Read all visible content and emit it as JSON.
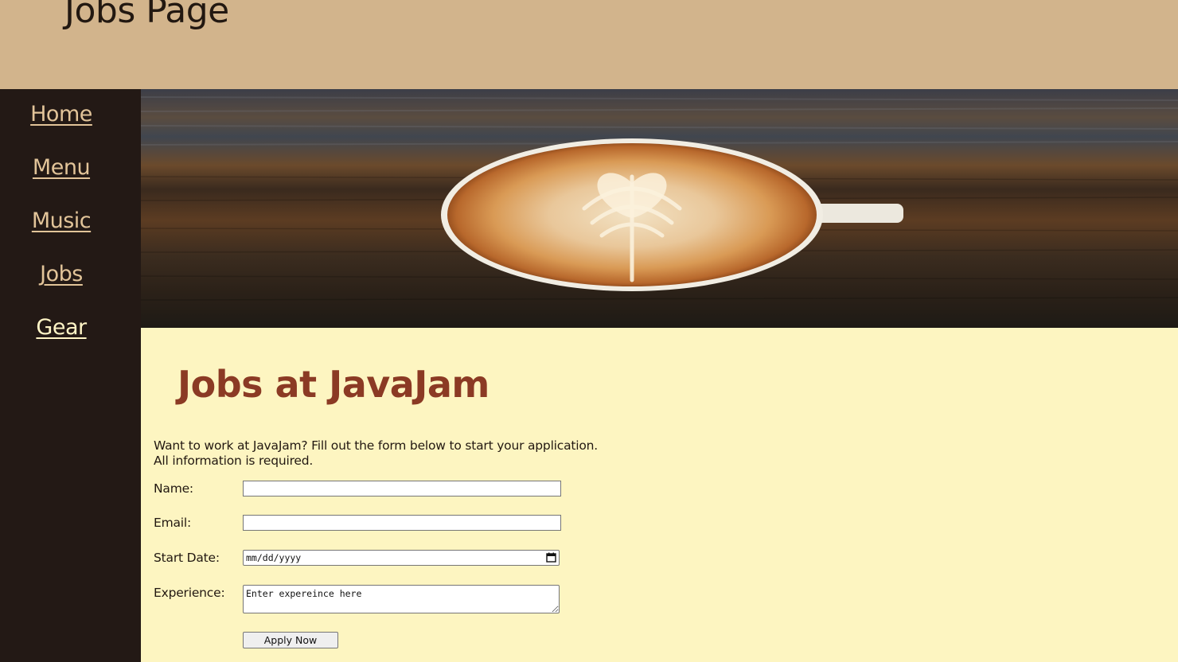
{
  "header": {
    "title": "Jobs Page"
  },
  "nav": {
    "items": [
      {
        "label": "Home"
      },
      {
        "label": "Menu"
      },
      {
        "label": "Music"
      },
      {
        "label": "Jobs"
      },
      {
        "label": "Gear"
      }
    ]
  },
  "main": {
    "heading": "Jobs at JavaJam",
    "intro_line1": "Want to work at JavaJam? Fill out the form below to start your application.",
    "intro_line2": "All information is required.",
    "form": {
      "name_label": "Name:",
      "name_value": "",
      "email_label": "Email:",
      "email_value": "",
      "start_date_label": "Start Date:",
      "start_date_placeholder": "mm/dd/yyyy",
      "experience_label": "Experience:",
      "experience_value": "Enter expereince here",
      "submit_label": "Apply Now"
    }
  },
  "colors": {
    "header_bg": "#d2b48c",
    "sidebar_bg": "#231915",
    "nav_link": "#e2c499",
    "nav_active": "#fff5c6",
    "content_bg": "#fdf5c1",
    "heading": "#8b3a24"
  },
  "icons": {
    "date_picker": "calendar-icon",
    "hero": "latte-art-coffee-cup-image"
  }
}
